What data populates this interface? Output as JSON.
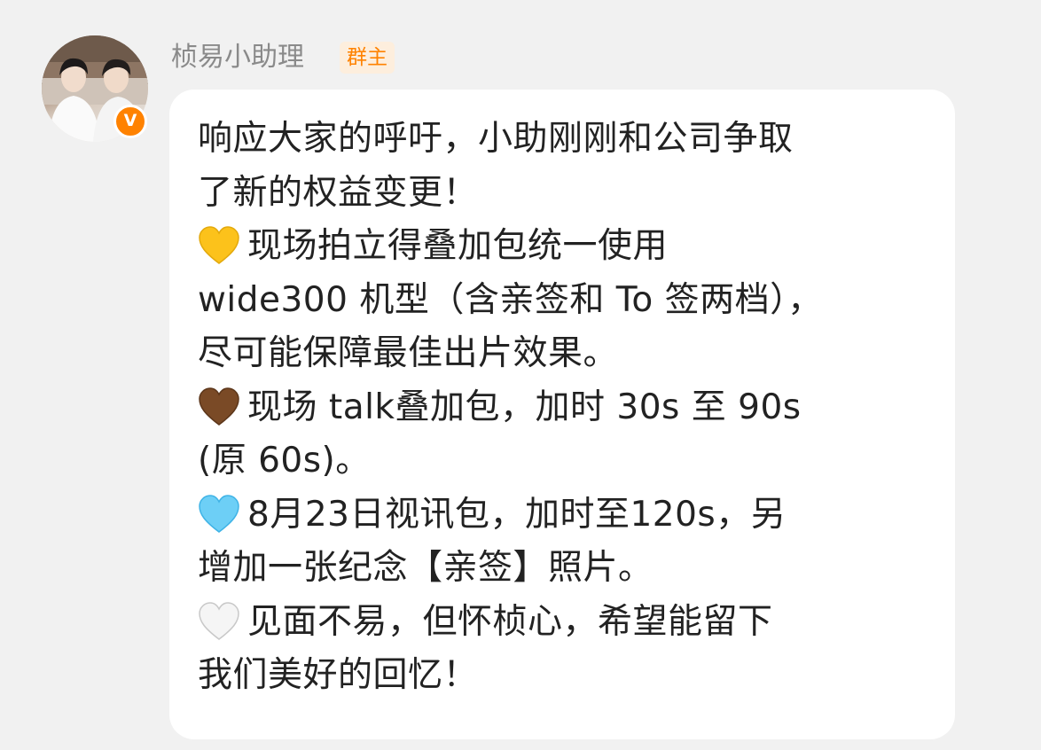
{
  "message": {
    "sender_name": "桢易小助理",
    "role_badge": "群主",
    "verified_mark": "V",
    "avatar": "avatar-photo",
    "lines": [
      {
        "emoji": "",
        "text": "响应大家的呼吁，小助刚刚和公司争取"
      },
      {
        "emoji": "",
        "text": "了新的权益变更！"
      },
      {
        "emoji": "yellow-heart-icon",
        "text": "现场拍立得叠加包统一使用"
      },
      {
        "emoji": "",
        "text": " wide300 机型（含亲签和 To 签两档），"
      },
      {
        "emoji": "",
        "text": "尽可能保障最佳出片效果。"
      },
      {
        "emoji": "brown-heart-icon",
        "text": "现场 talk叠加包，加时 30s 至 90s"
      },
      {
        "emoji": "",
        "text": "(原 60s)。"
      },
      {
        "emoji": "light-blue-heart-icon",
        "text": "8月23日视讯包，加时至120s，另"
      },
      {
        "emoji": "",
        "text": "增加一张纪念【亲签】照片。"
      },
      {
        "emoji": "white-heart-icon",
        "text": "见面不易，但怀桢心，希望能留下"
      },
      {
        "emoji": "",
        "text": "我们美好的回忆！"
      }
    ]
  },
  "colors": {
    "page_background": "#f1f1f1",
    "bubble_background": "#ffffff",
    "accent_orange": "#ff8200",
    "badge_background": "#fdeedd",
    "name_gray": "#8a8a8a",
    "text": "#222222",
    "yellow_heart": "#fcc21b",
    "brown_heart": "#7a4a26",
    "light_blue_heart": "#6dcff6",
    "white_heart": "#f5f5f5"
  }
}
